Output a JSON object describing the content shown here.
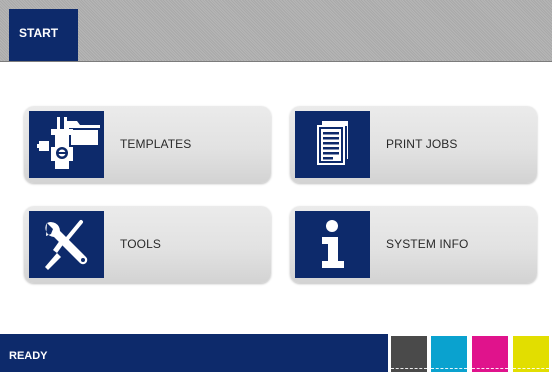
{
  "header": {
    "start_tab_label": "START"
  },
  "tiles": [
    {
      "label": "TEMPLATES",
      "icon": "templates-icon"
    },
    {
      "label": "PRINT JOBS",
      "icon": "print-jobs-icon"
    },
    {
      "label": "TOOLS",
      "icon": "tools-icon"
    },
    {
      "label": "SYSTEM INFO",
      "icon": "system-info-icon"
    }
  ],
  "status": {
    "text": "READY"
  },
  "ink_swatches": [
    {
      "name": "black",
      "color": "#4a4a4a"
    },
    {
      "name": "cyan",
      "color": "#0aa2cf"
    },
    {
      "name": "magenta",
      "color": "#e0138c"
    },
    {
      "name": "yellow",
      "color": "#e2de00"
    }
  ],
  "colors": {
    "brand_navy": "#0d2a6b"
  }
}
